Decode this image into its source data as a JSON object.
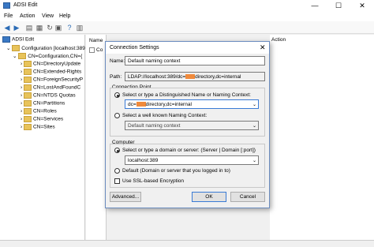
{
  "window": {
    "title": "ADSI Edit",
    "controls": {
      "minimize": "—",
      "maximize": "☐",
      "close": "✕"
    }
  },
  "menu": [
    "File",
    "Action",
    "View",
    "Help"
  ],
  "tree": {
    "root": "ADSI Edit",
    "items": [
      "Configuration [localhost:389",
      "CN=Configuration,CN={",
      "CN=DirectoryUpdate",
      "CN=Extended-Rights",
      "CN=ForeignSecurityP",
      "CN=LostAndFoundC",
      "CN=NTDS Quotas",
      "CN=Partitions",
      "CN=Roles",
      "CN=Services",
      "CN=Sites"
    ]
  },
  "middle_pane": {
    "header": "Name",
    "row": "Co"
  },
  "right_pane": {
    "header": "Action"
  },
  "dialog": {
    "title": "Connection Settings",
    "close": "✕",
    "name_label": "Name:",
    "name_value": "Default naming context",
    "path_label": "Path:",
    "path_value_prefix": "LDAP://localhost:389/dc=",
    "path_value_suffix": "directory,dc=internal",
    "connection_point_label": "Connection Point",
    "radio_dn_label": "Select or type a Distinguished Name or Naming Context:",
    "dn_value_prefix": "dc=",
    "dn_value_suffix": "directory,dc=internal",
    "radio_wk_label": "Select a well known Naming Context:",
    "wk_value": "Default naming context",
    "computer_label": "Computer",
    "radio_server_label": "Select or type a domain or server: (Server | Domain [:port])",
    "server_value": "localhost:389",
    "radio_default_label": "Default (Domain or server that you logged in to)",
    "ssl_label": "Use SSL-based Encryption",
    "advanced_button": "Advanced...",
    "ok_button": "OK",
    "cancel_button": "Cancel"
  },
  "colors": {
    "accent": "#3a7bd5",
    "redaction": "#f08a3c",
    "folder": "#e8c35a"
  }
}
